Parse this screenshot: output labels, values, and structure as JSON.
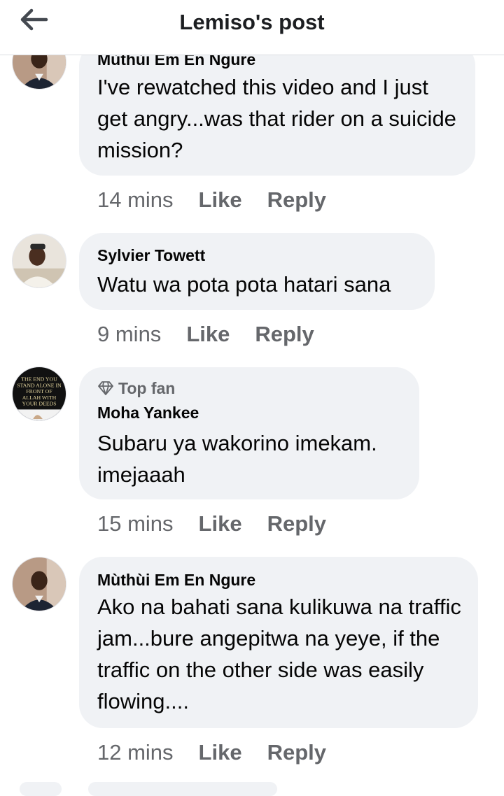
{
  "header": {
    "title": "Lemiso's post",
    "back_icon": "arrow-left-icon"
  },
  "comments": [
    {
      "author": "Mùthùi Em En Ngure",
      "badge": "",
      "text": "I've rewatched this video and I just get angry...was that rider on a suicide mission?",
      "time": "14 mins",
      "like_label": "Like",
      "reply_label": "Reply"
    },
    {
      "author": "Sylvier Towett",
      "badge": "",
      "text": "Watu wa pota pota hatari sana",
      "time": "9 mins",
      "like_label": "Like",
      "reply_label": "Reply"
    },
    {
      "author": "Moha Yankee",
      "badge": "Top fan",
      "avatar_text": "THE END YOU STAND ALONE IN FRONT OF ALLAH WITH YOUR DEEDS",
      "text": "Subaru ya wakorino imekam. imejaaah",
      "time": "15 mins",
      "like_label": "Like",
      "reply_label": "Reply"
    },
    {
      "author": "Mùthùi Em En Ngure",
      "badge": "",
      "text": "Ako na bahati sana kulikuwa na traffic jam...bure angepitwa na yeye, if the traffic on the other side was easily flowing....",
      "time": "12 mins",
      "like_label": "Like",
      "reply_label": "Reply"
    }
  ],
  "colors": {
    "bubble": "#f0f2f5",
    "meta": "#65676b",
    "text": "#050505"
  }
}
